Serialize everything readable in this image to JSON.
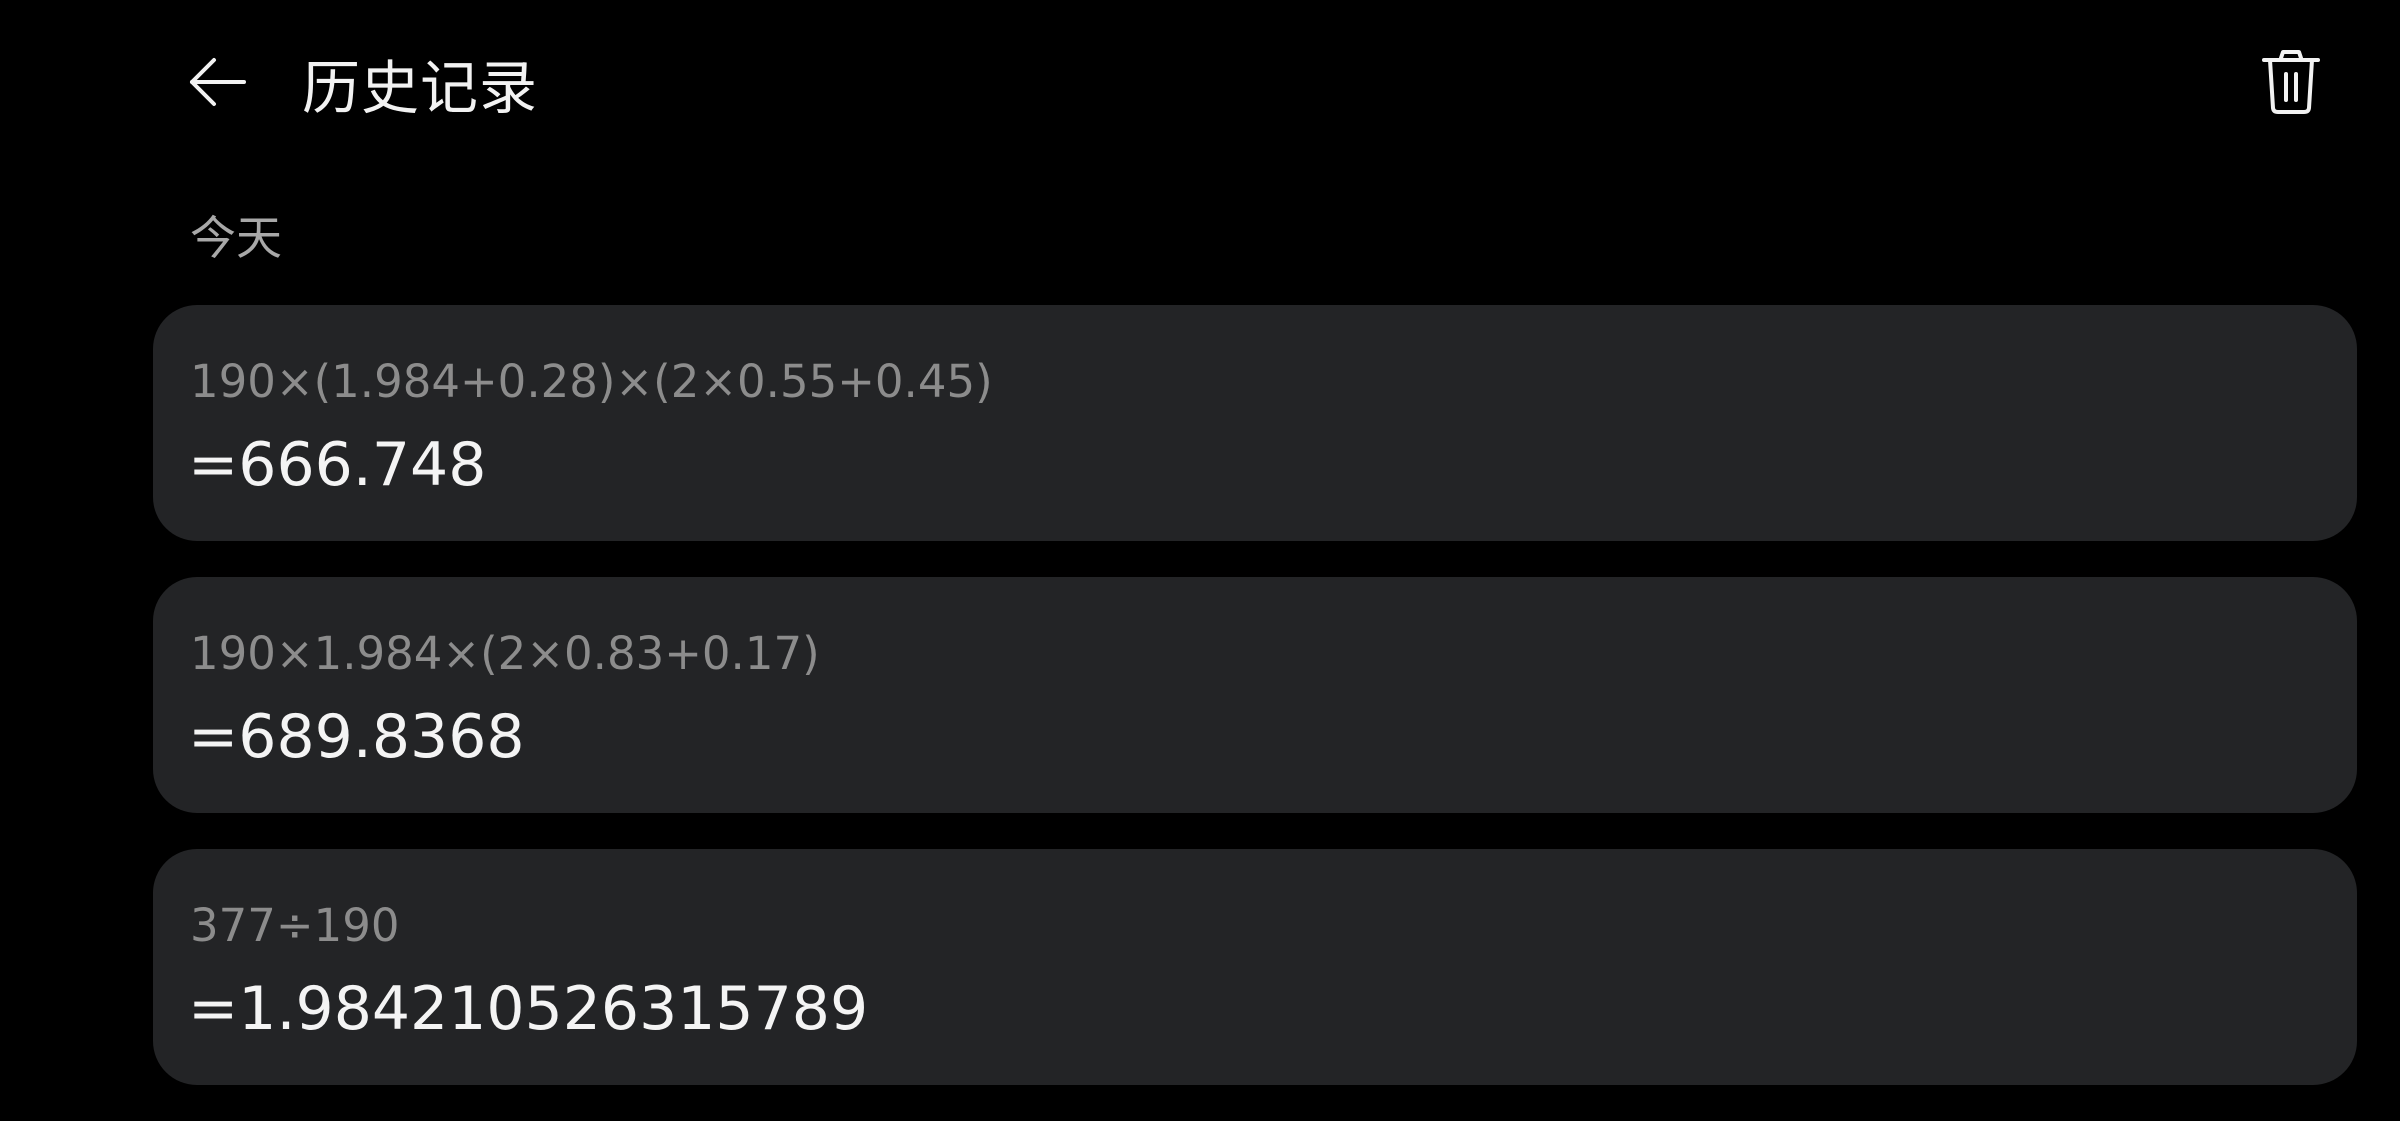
{
  "header": {
    "title": "历史记录",
    "back_icon": "arrow-left-icon",
    "clear_icon": "trash-icon"
  },
  "section": {
    "label": "今天"
  },
  "history": [
    {
      "expression": "190×(1.984+0.28)×(2×0.55+0.45)",
      "result": "=666.748"
    },
    {
      "expression": "190×1.984×(2×0.83+0.17)",
      "result": "=689.8368"
    },
    {
      "expression": "377÷190",
      "result": "=1.984210526315789"
    }
  ],
  "colors": {
    "background": "#000000",
    "card": "#232426",
    "expression_text": "#8c8c8c",
    "result_text": "#f4f4f4",
    "section_text": "#a8a8a8"
  }
}
